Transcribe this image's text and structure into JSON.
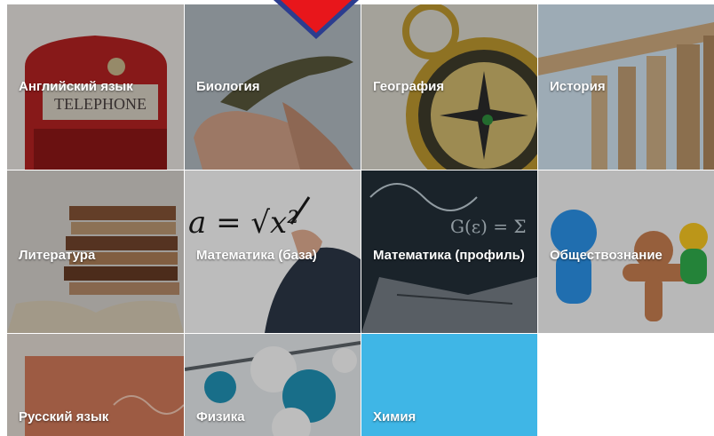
{
  "subjects": [
    {
      "id": "english",
      "label": "Английский язык"
    },
    {
      "id": "biology",
      "label": "Биология"
    },
    {
      "id": "geography",
      "label": "География"
    },
    {
      "id": "history",
      "label": "История"
    },
    {
      "id": "literature",
      "label": "Литература"
    },
    {
      "id": "math-base",
      "label": "Математика (база)"
    },
    {
      "id": "math-profile",
      "label": "Математика (профиль)"
    },
    {
      "id": "social",
      "label": "Обществознание"
    },
    {
      "id": "russian",
      "label": "Русский язык"
    },
    {
      "id": "physics",
      "label": "Физика"
    },
    {
      "id": "chemistry",
      "label": "Химия"
    }
  ],
  "art": {
    "telephone_sign": "TELEPHONE",
    "formula_math_base": "a = √x²",
    "formula_math_profile": "G(ε) = Σ"
  },
  "colors": {
    "chemistry_tile": "#3fb6e6",
    "arrow": "#e8161b",
    "arrow_outline": "#2c3d8f"
  }
}
